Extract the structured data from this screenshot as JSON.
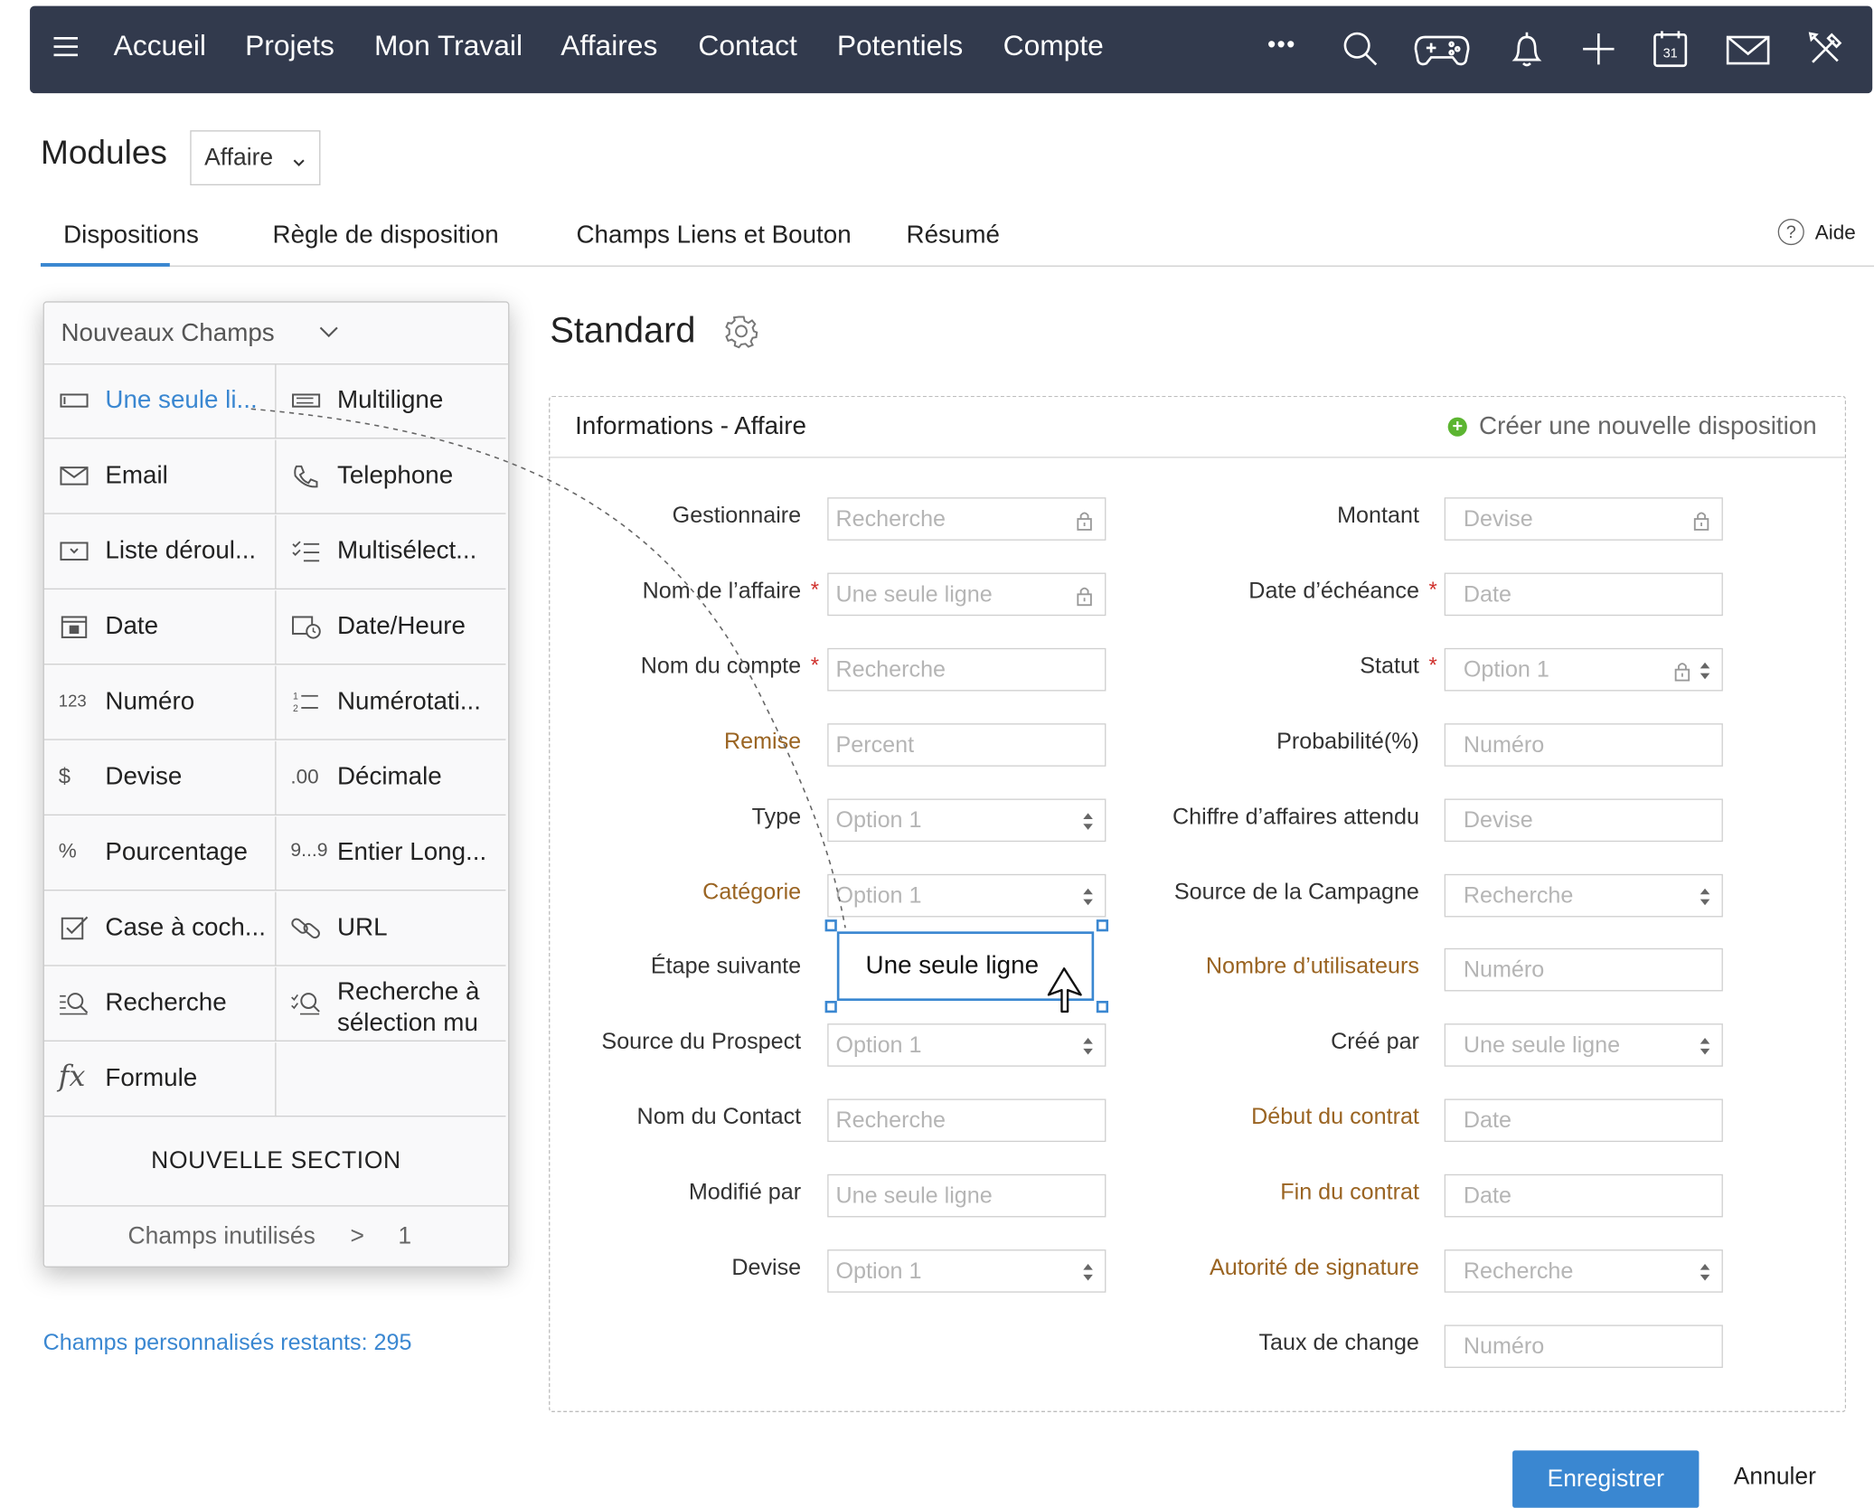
{
  "nav": {
    "items": [
      "Accueil",
      "Projets",
      "Mon Travail",
      "Affaires",
      "Contact",
      "Potentiels",
      "Compte"
    ],
    "more": "•••",
    "icons": [
      "search-icon",
      "gamepad-icon",
      "bell-icon",
      "plus-icon",
      "calendar-icon",
      "mail-icon",
      "tools-icon"
    ],
    "calendar_day": "31"
  },
  "modules": {
    "title": "Modules",
    "selected": "Affaire"
  },
  "tabs": {
    "items": [
      "Dispositions",
      "Règle de disposition",
      "Champs Liens et Bouton",
      "Résumé"
    ],
    "active": "Dispositions",
    "help": "Aide"
  },
  "panel": {
    "header": "Nouveaux Champs",
    "fields": [
      {
        "icon": "single-line-icon",
        "label": "Une seule li..."
      },
      {
        "icon": "multiline-icon",
        "label": "Multiligne"
      },
      {
        "icon": "email-icon",
        "label": "Email"
      },
      {
        "icon": "phone-icon",
        "label": "Telephone"
      },
      {
        "icon": "dropdown-icon",
        "label": "Liste déroul..."
      },
      {
        "icon": "multiselect-icon",
        "label": "Multisélect..."
      },
      {
        "icon": "date-icon",
        "label": "Date"
      },
      {
        "icon": "datetime-icon",
        "label": "Date/Heure"
      },
      {
        "icon": "number-icon",
        "label": "Numéro",
        "icon_text": "123"
      },
      {
        "icon": "autonumber-icon",
        "label": "Numérotati..."
      },
      {
        "icon": "currency-icon",
        "label": "Devise",
        "icon_text": "$"
      },
      {
        "icon": "decimal-icon",
        "label": "Décimale",
        "icon_text": ".00"
      },
      {
        "icon": "percent-icon",
        "label": "Pourcentage",
        "icon_text": "%"
      },
      {
        "icon": "long-integer-icon",
        "label": "Entier Long...",
        "icon_text": "9...9"
      },
      {
        "icon": "checkbox-icon",
        "label": "Case à coch..."
      },
      {
        "icon": "url-icon",
        "label": "URL"
      },
      {
        "icon": "lookup-icon",
        "label": "Recherche"
      },
      {
        "icon": "multi-lookup-icon",
        "label": "Recherche à sélection mu"
      },
      {
        "icon": "formula-icon",
        "label": "Formule",
        "icon_text": "fx"
      }
    ],
    "new_section": "NOUVELLE SECTION",
    "unused_label": "Champs inutilisés",
    "unused_arrow": ">",
    "unused_count": "1"
  },
  "remaining": "Champs personnalisés restants: 295",
  "layout": {
    "title": "Standard",
    "section_title": "Informations - Affaire",
    "create_layout": "Créer une nouvelle disposition",
    "left_fields": [
      {
        "label": "Gestionnaire",
        "placeholder": "Recherche",
        "required": false,
        "custom": false,
        "control": "lock"
      },
      {
        "label": "Nom de l’affaire",
        "placeholder": "Une seule ligne",
        "required": true,
        "custom": false,
        "control": "lock"
      },
      {
        "label": "Nom du compte",
        "placeholder": "Recherche",
        "required": true,
        "custom": false,
        "control": "none"
      },
      {
        "label": "Remise",
        "placeholder": "Percent",
        "required": false,
        "custom": true,
        "control": "none"
      },
      {
        "label": "Type",
        "placeholder": "Option 1",
        "required": false,
        "custom": false,
        "control": "updown"
      },
      {
        "label": "Catégorie",
        "placeholder": "Option 1",
        "required": false,
        "custom": true,
        "control": "updown"
      },
      {
        "label": "Étape suivante",
        "placeholder": "",
        "required": false,
        "custom": false,
        "control": "drop"
      },
      {
        "label": "Source du Prospect",
        "placeholder": "Option 1",
        "required": false,
        "custom": false,
        "control": "updown"
      },
      {
        "label": "Nom du Contact",
        "placeholder": "Recherche",
        "required": false,
        "custom": false,
        "control": "none"
      },
      {
        "label": "Modifié par",
        "placeholder": "Une seule ligne",
        "required": false,
        "custom": false,
        "control": "none"
      },
      {
        "label": "Devise",
        "placeholder": "Option 1",
        "required": false,
        "custom": false,
        "control": "updown"
      }
    ],
    "right_fields": [
      {
        "label": "Montant",
        "placeholder": "Devise",
        "required": false,
        "custom": false,
        "control": "lock"
      },
      {
        "label": "Date d’échéance",
        "placeholder": "Date",
        "required": true,
        "custom": false,
        "control": "none"
      },
      {
        "label": "Statut",
        "placeholder": "Option 1",
        "required": true,
        "custom": false,
        "control": "lockupdown"
      },
      {
        "label": "Probabilité(%)",
        "placeholder": "Numéro",
        "required": false,
        "custom": false,
        "control": "none"
      },
      {
        "label": "Chiffre d’affaires attendu",
        "placeholder": "Devise",
        "required": false,
        "custom": false,
        "control": "none"
      },
      {
        "label": "Source de la Campagne",
        "placeholder": "Recherche",
        "required": false,
        "custom": false,
        "control": "updown"
      },
      {
        "label": "Nombre d’utilisateurs",
        "placeholder": "Numéro",
        "required": false,
        "custom": true,
        "control": "none"
      },
      {
        "label": "Créé par",
        "placeholder": "Une seule ligne",
        "required": false,
        "custom": false,
        "control": "updown"
      },
      {
        "label": "Début du contrat",
        "placeholder": "Date",
        "required": false,
        "custom": true,
        "control": "none"
      },
      {
        "label": "Fin du contrat",
        "placeholder": "Date",
        "required": false,
        "custom": true,
        "control": "none"
      },
      {
        "label": "Autorité de signature",
        "placeholder": "Recherche",
        "required": false,
        "custom": true,
        "control": "updown"
      },
      {
        "label": "Taux de change",
        "placeholder": "Numéro",
        "required": false,
        "custom": false,
        "control": "none"
      }
    ],
    "dragging_label": "Une seule ligne",
    "required_mark": "*"
  },
  "actions": {
    "save": "Enregistrer",
    "cancel": "Annuler"
  },
  "colors": {
    "nav_bg": "#323a4d",
    "accent": "#3a87d1",
    "custom_label": "#9a6422",
    "required": "#d0312d",
    "create_icon": "#5cb531"
  }
}
